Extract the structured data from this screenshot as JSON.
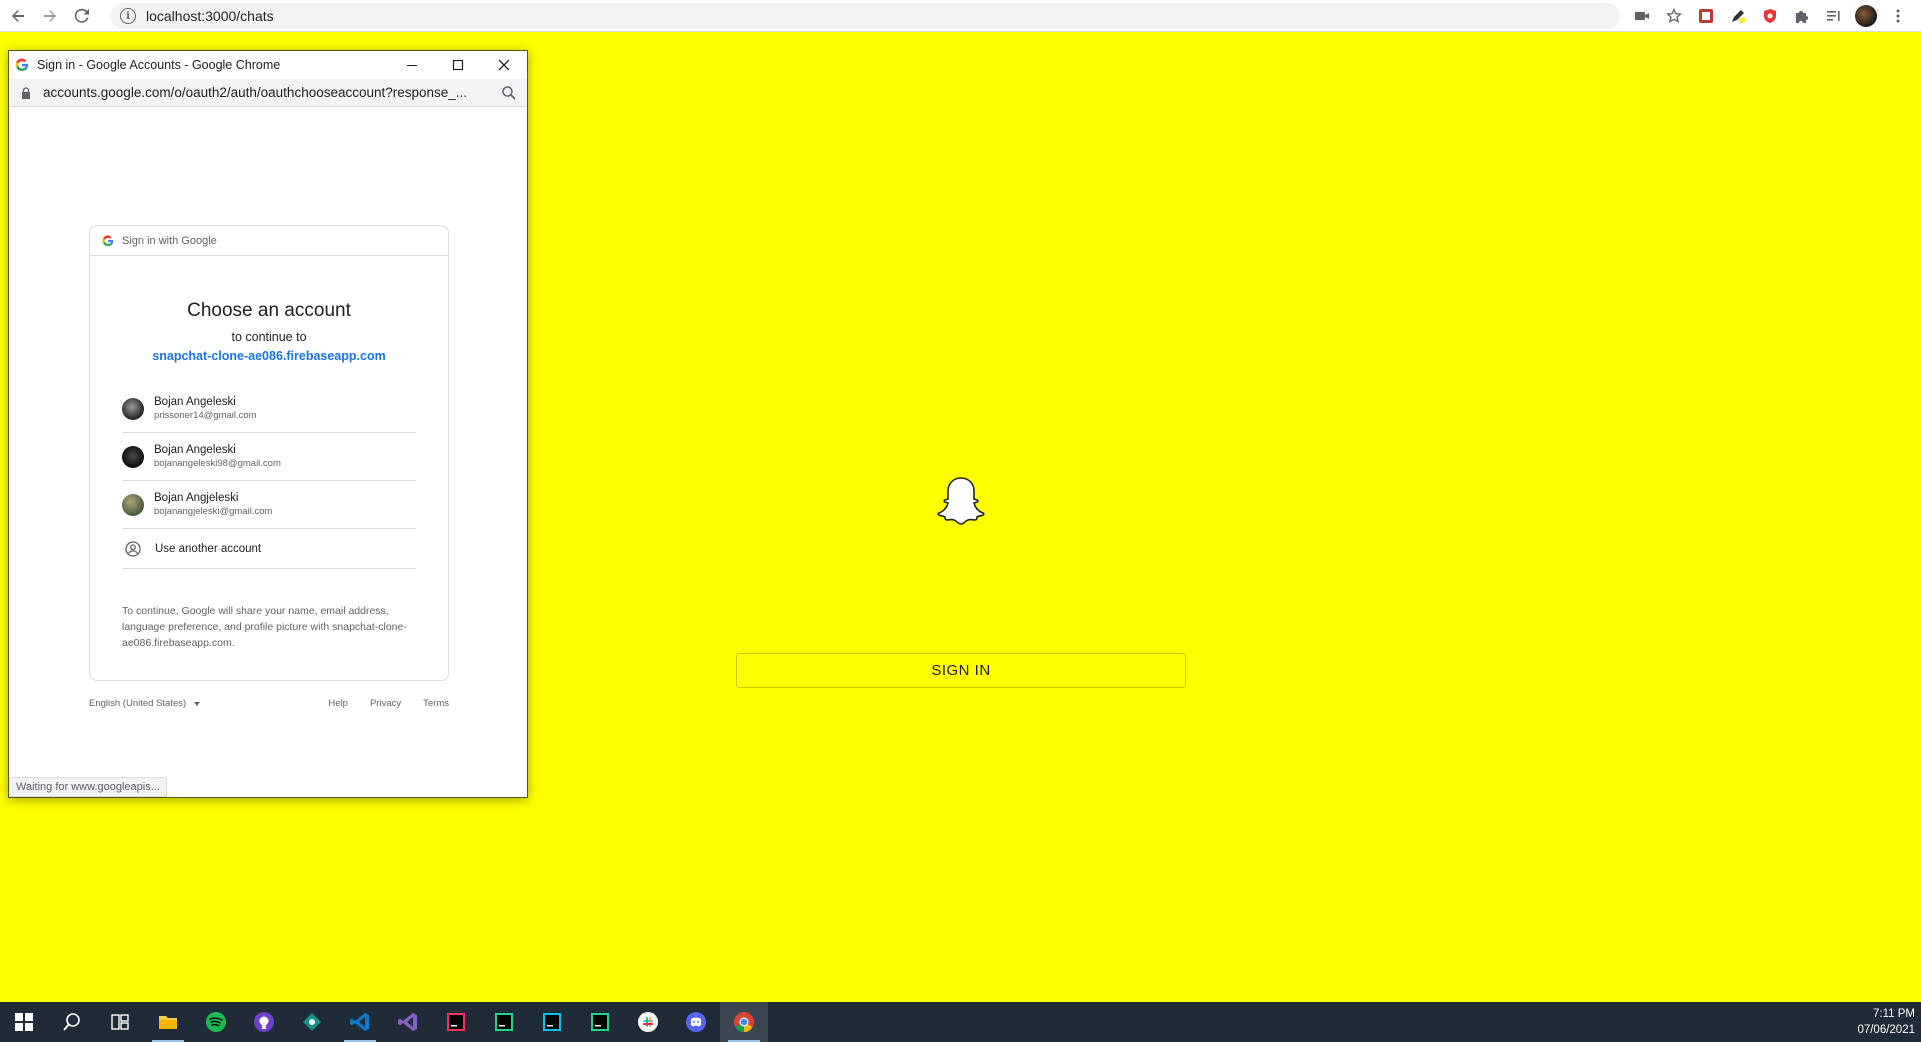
{
  "browser": {
    "url": "localhost:3000/chats",
    "extensions": [
      "camera-icon",
      "star-icon",
      "ext-red-icon",
      "pen-icon",
      "shield-icon",
      "puzzle-icon",
      "reading-list-icon",
      "profile-avatar",
      "kebab-menu-icon"
    ]
  },
  "app": {
    "sign_in_label": "SIGN IN",
    "bg_color": "#ffff00"
  },
  "popup": {
    "title": "Sign in - Google Accounts - Google Chrome",
    "url": "accounts.google.com/o/oauth2/auth/oauthchooseaccount?response_...",
    "header": "Sign in with Google",
    "heading": "Choose an account",
    "subheading": "to continue to",
    "app_link": "snapchat-clone-ae086.firebaseapp.com",
    "accounts": [
      {
        "name": "Bojan Angeleski",
        "email": "prissoner14@gmail.com"
      },
      {
        "name": "Bojan Angeleski",
        "email": "bojanangeleski98@gmail.com"
      },
      {
        "name": "Bojan Angjeleski",
        "email": "bojanangjeleski@gmail.com"
      }
    ],
    "use_another": "Use another account",
    "disclaimer": "To continue, Google will share your name, email address, language preference, and profile picture with snapchat-clone-ae086.firebaseapp.com.",
    "language": "English (United States)",
    "footer_links": {
      "help": "Help",
      "privacy": "Privacy",
      "terms": "Terms"
    },
    "status": "Waiting for www.googleapis..."
  },
  "taskbar": {
    "time": "7:11 PM",
    "date": "07/06/2021",
    "apps": [
      "start",
      "search",
      "task-view",
      "file-explorer",
      "spotify",
      "github-desktop",
      "git-kraken",
      "vscode",
      "visual-studio",
      "intellij",
      "pycharm",
      "webstorm",
      "clion",
      "slack",
      "discord",
      "chrome"
    ]
  }
}
